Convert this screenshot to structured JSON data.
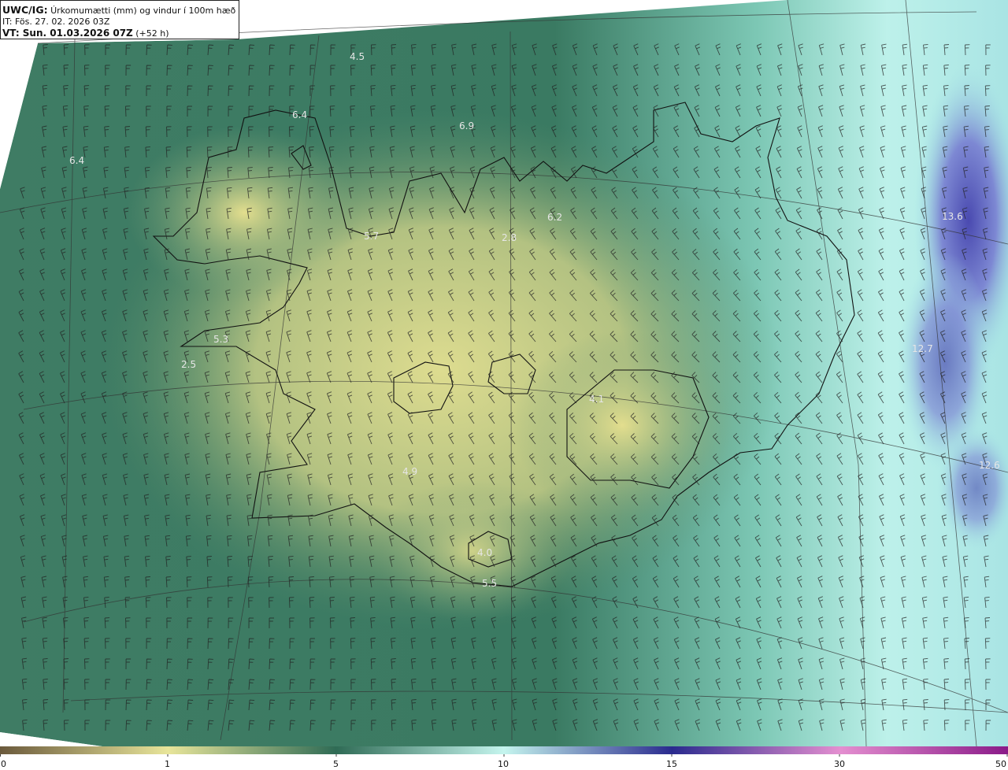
{
  "header": {
    "model": "UWC/IG:",
    "variable": "Úrkomumætti (mm) og vindur í 100m hæð",
    "init_time": "IT: Fös. 27. 02. 2026 03Z",
    "valid_prefix": "VT: Sun. 01.03.2026 07Z",
    "valid_suffix": " (+52 h)"
  },
  "colorbar": {
    "ticks": [
      "0",
      "1",
      "5",
      "10",
      "15",
      "30",
      "50"
    ],
    "colors": [
      "#6b5a3c",
      "#e8e59a",
      "#2f6b55",
      "#c5f5ee",
      "#2a2a8e",
      "#e48fd0",
      "#8a1a88"
    ]
  },
  "value_labels": [
    {
      "text": "4.5"
    },
    {
      "text": "6.4"
    },
    {
      "text": "6.9"
    },
    {
      "text": "6.4"
    },
    {
      "text": "5.7"
    },
    {
      "text": "6.2"
    },
    {
      "text": "2.8"
    },
    {
      "text": "13.6"
    },
    {
      "text": "5.3"
    },
    {
      "text": "2.5"
    },
    {
      "text": "12.7"
    },
    {
      "text": "4.1"
    },
    {
      "text": "4.9"
    },
    {
      "text": "12.6"
    },
    {
      "text": "4.0"
    },
    {
      "text": "5.5"
    }
  ]
}
